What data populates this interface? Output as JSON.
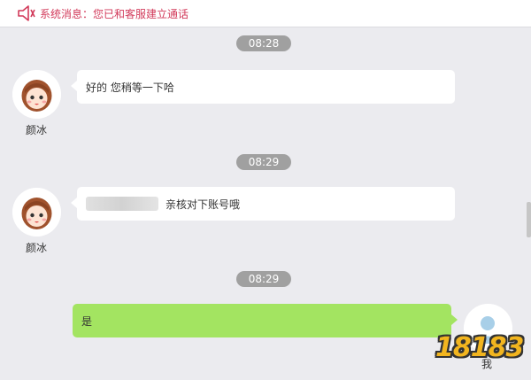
{
  "header": {
    "notice_text": "系统消息：您已和客服建立通话",
    "icon": "speaker-icon",
    "accent_color": "#d23a5a"
  },
  "messages": [
    {
      "time": "08:28",
      "sender": "颜冰",
      "side": "left",
      "text": "好的 您稍等一下哈"
    },
    {
      "time": "08:29",
      "sender": "颜冰",
      "side": "left",
      "text": "亲核对下账号哦"
    },
    {
      "time": "08:29",
      "sender": "我",
      "side": "right",
      "text": "是"
    }
  ],
  "colors": {
    "background": "#ebebef",
    "agent_bubble": "#ffffff",
    "user_bubble": "#a3e461",
    "time_pill": "#a0a0a0"
  },
  "watermark": {
    "text": "18183"
  }
}
